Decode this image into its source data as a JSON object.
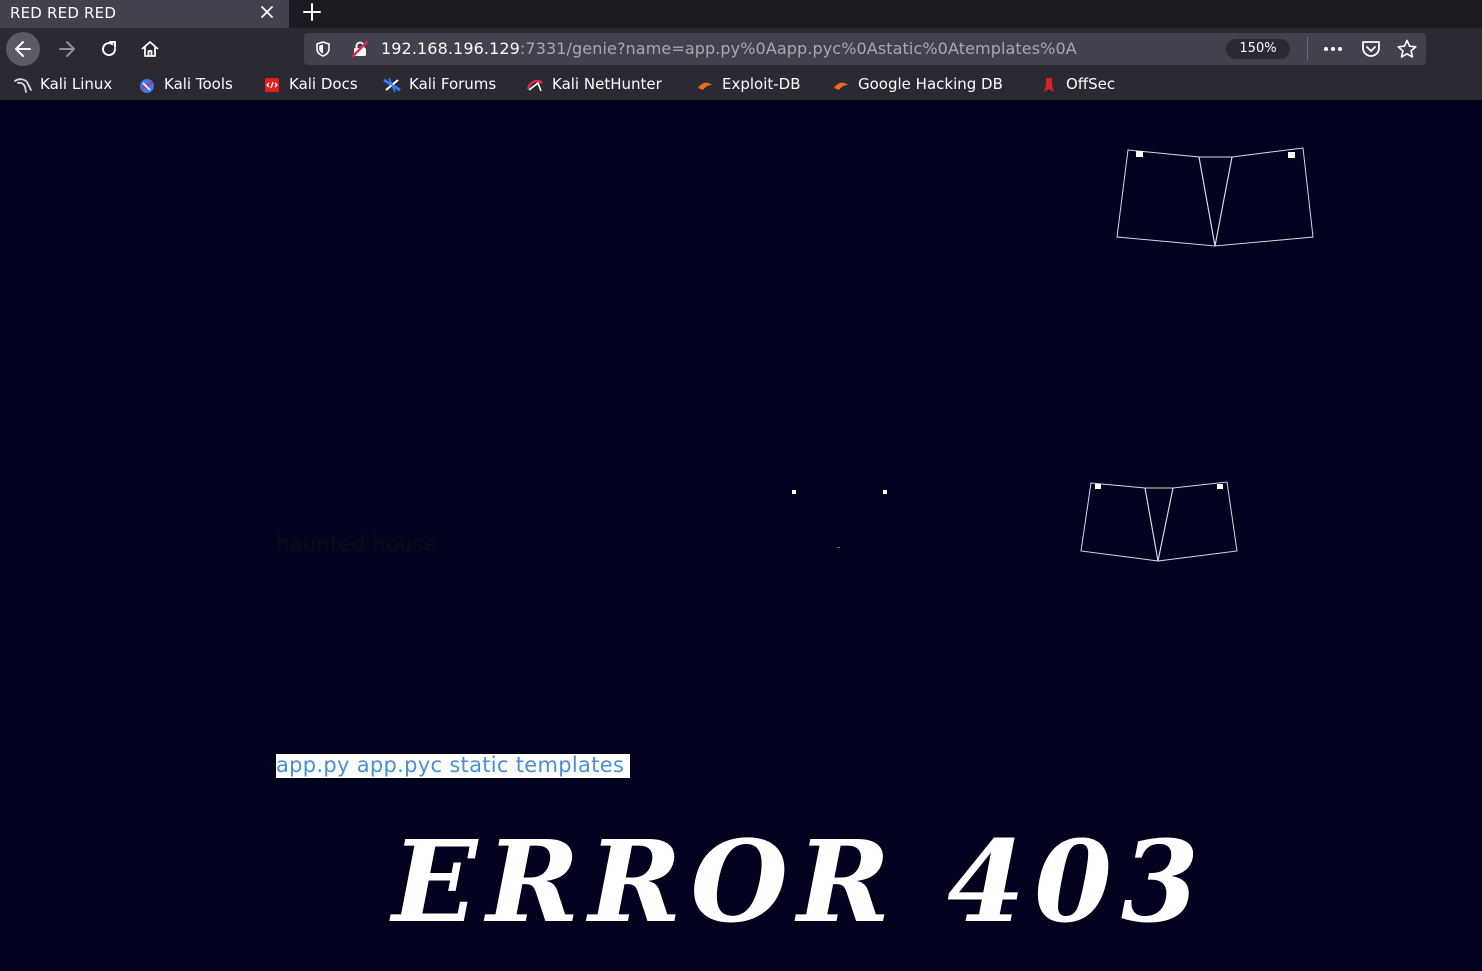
{
  "browser": {
    "tab": {
      "title": "RED RED RED"
    },
    "address": {
      "host": "192.168.196.129",
      "rest": ":7331/genie?name=app.py%0Aapp.pyc%0Astatic%0Atemplates%0A",
      "zoom": "150%"
    },
    "bookmarks": [
      {
        "label": "Kali Linux",
        "icon": "kali-dragon-icon"
      },
      {
        "label": "Kali Tools",
        "icon": "kali-tools-icon"
      },
      {
        "label": "Kali Docs",
        "icon": "kali-docs-icon"
      },
      {
        "label": "Kali Forums",
        "icon": "kali-forums-icon"
      },
      {
        "label": "Kali NetHunter",
        "icon": "nethunter-icon"
      },
      {
        "label": "Exploit-DB",
        "icon": "exploit-db-icon"
      },
      {
        "label": "Google Hacking DB",
        "icon": "ghdb-icon"
      },
      {
        "label": "OffSec",
        "icon": "offsec-icon"
      }
    ]
  },
  "page": {
    "haunted_text": "haunted house",
    "listing": "app.py app.pyc static templates",
    "error_heading": "ERROR 403"
  },
  "colors": {
    "page_bg": "#02021f",
    "listing_text": "#4a8fd6",
    "chrome_bg": "#2b2a33"
  }
}
